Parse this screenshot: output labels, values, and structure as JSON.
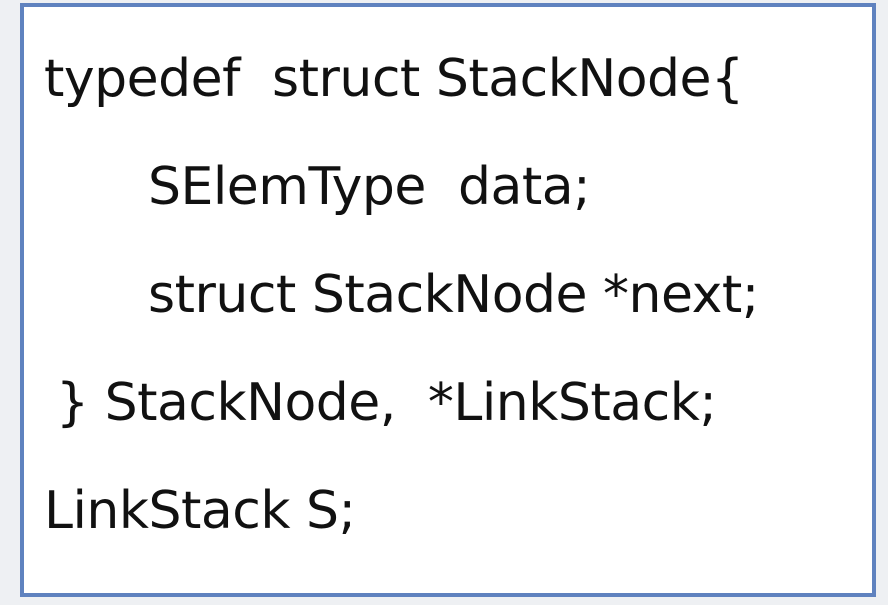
{
  "code_box": {
    "border_color": "#5f82bf",
    "lines": [
      "typedef  struct StackNode{",
      "SElemType  data;",
      "struct StackNode *next;",
      "} StackNode,  *LinkStack;",
      "LinkStack S;"
    ]
  }
}
